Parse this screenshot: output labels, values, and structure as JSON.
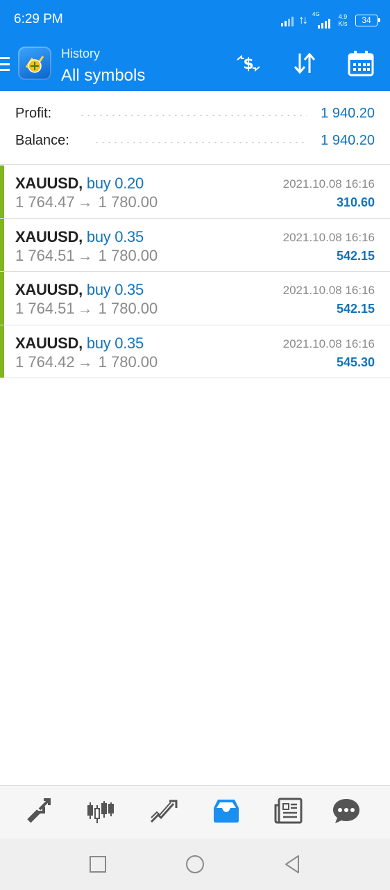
{
  "status_bar": {
    "time": "6:29 PM",
    "network_type": "4G",
    "speed_value": "4.9",
    "speed_unit": "K/s",
    "battery": "34"
  },
  "header": {
    "subtitle": "History",
    "title": "All symbols",
    "actions": [
      "currency-icon",
      "sort-icon",
      "calendar-icon"
    ]
  },
  "summary": {
    "profit_label": "Profit:",
    "profit_value": "1 940.20",
    "balance_label": "Balance:",
    "balance_value": "1 940.20"
  },
  "deals": [
    {
      "symbol": "XAUUSD,",
      "type": "buy 0.20",
      "open_price": "1 764.47",
      "arrow": "→",
      "close_price": "1 780.00",
      "datetime": "2021.10.08 16:16",
      "profit": "310.60"
    },
    {
      "symbol": "XAUUSD,",
      "type": "buy 0.35",
      "open_price": "1 764.51",
      "arrow": "→",
      "close_price": "1 780.00",
      "datetime": "2021.10.08 16:16",
      "profit": "542.15"
    },
    {
      "symbol": "XAUUSD,",
      "type": "buy 0.35",
      "open_price": "1 764.51",
      "arrow": "→",
      "close_price": "1 780.00",
      "datetime": "2021.10.08 16:16",
      "profit": "542.15"
    },
    {
      "symbol": "XAUUSD,",
      "type": "buy 0.35",
      "open_price": "1 764.42",
      "arrow": "→",
      "close_price": "1 780.00",
      "datetime": "2021.10.08 16:16",
      "profit": "545.30"
    }
  ],
  "bottom_tabs": [
    "quotes-icon",
    "chart-icon",
    "trade-icon",
    "history-icon",
    "news-icon",
    "messages-icon"
  ],
  "active_tab": "history-icon",
  "colors": {
    "appbar": "#0f87f0",
    "accent_blue": "#1273bd",
    "buy_bar": "#7fb51d",
    "muted_text": "#8a8a8a"
  }
}
